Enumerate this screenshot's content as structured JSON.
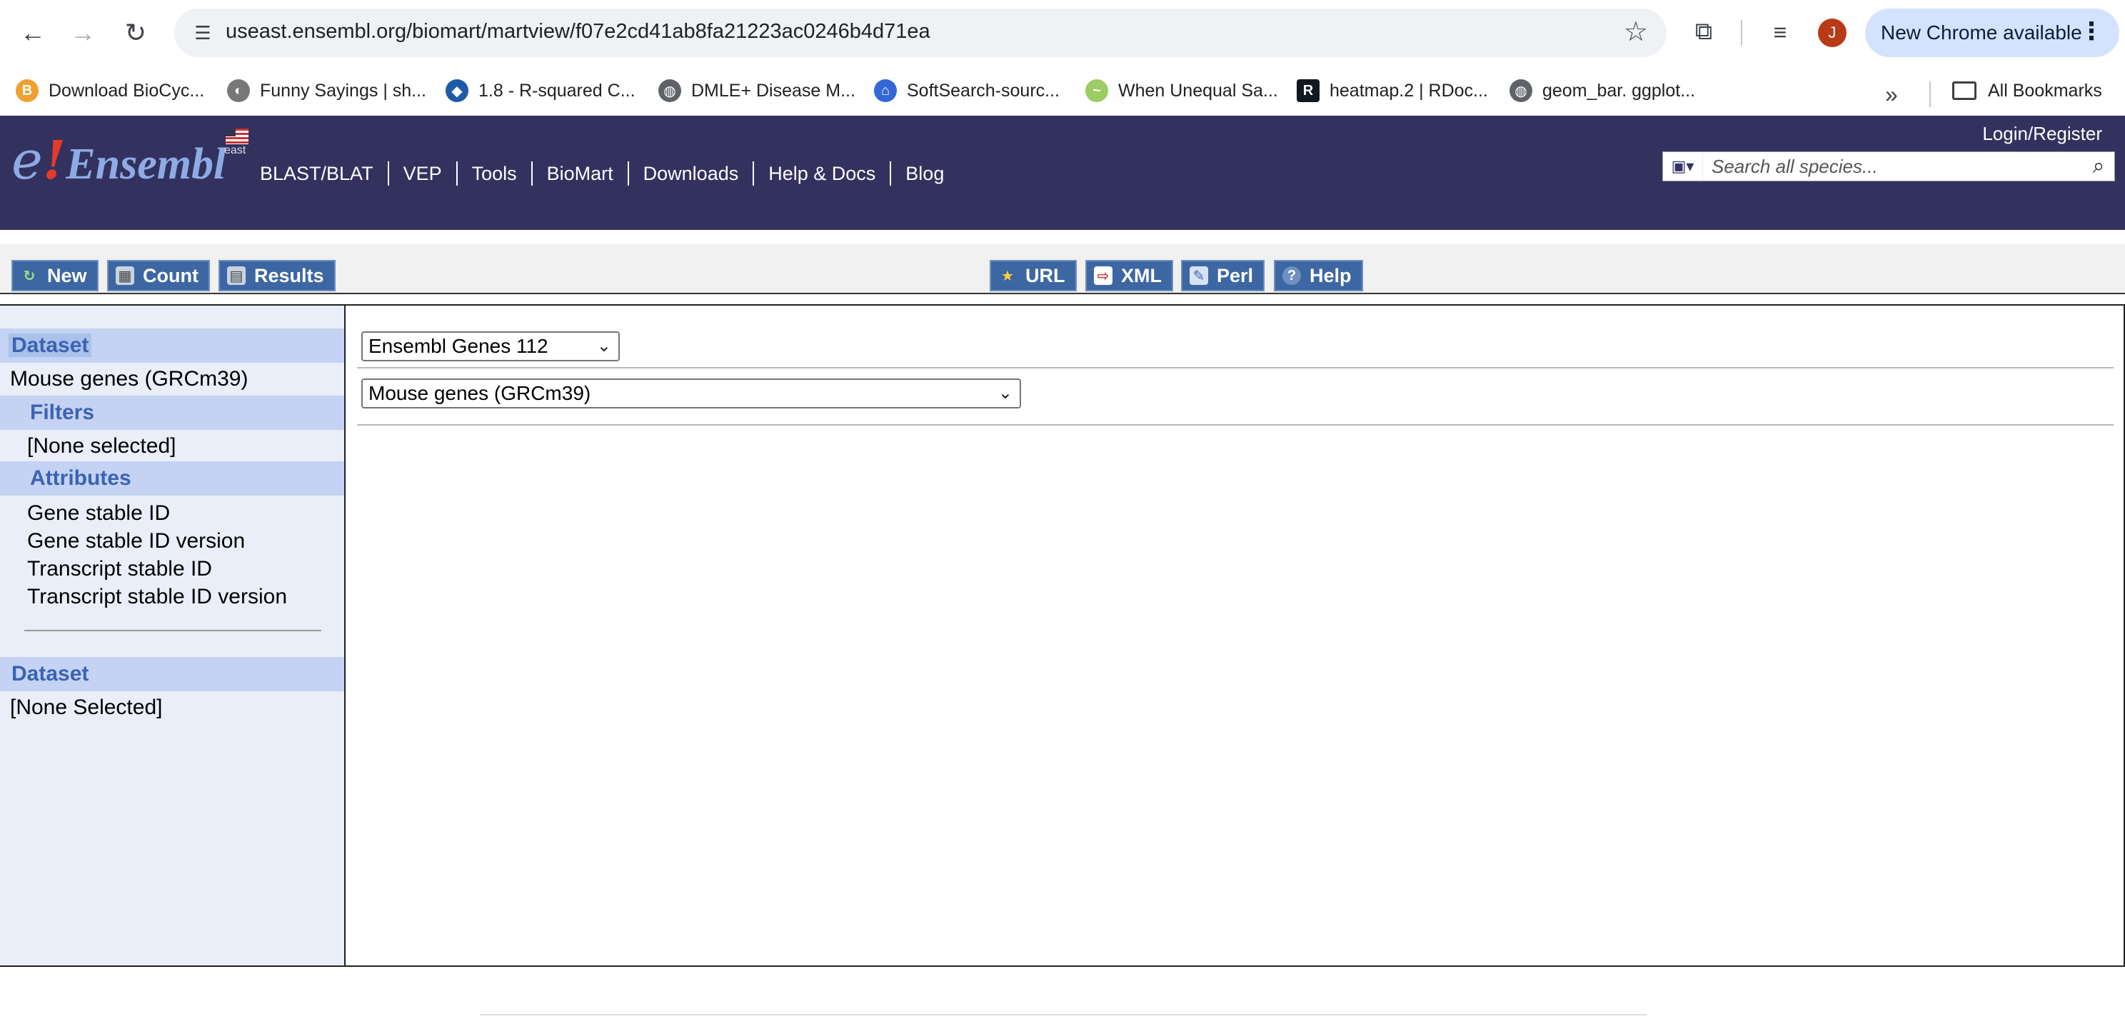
{
  "browser": {
    "url": "useast.ensembl.org/biomart/martview/f07e2cd41ab8fa21223ac0246b4d71ea",
    "profile_initial": "J",
    "update_label": "New Chrome available",
    "bookmarks": [
      {
        "label": "Download BioCyc...",
        "color": "#f0a030",
        "glyph": "B"
      },
      {
        "label": "Funny Sayings | sh...",
        "color": "#777777",
        "glyph": "◐"
      },
      {
        "label": "1.8 - R-squared C...",
        "color": "#1f5aa8",
        "glyph": "◆"
      },
      {
        "label": "DMLE+ Disease M...",
        "color": "#5f6368",
        "glyph": "◍"
      },
      {
        "label": "SoftSearch-sourc...",
        "color": "#3367d6",
        "glyph": "⌂"
      },
      {
        "label": "When Unequal Sa...",
        "color": "#9ccc65",
        "glyph": "~"
      },
      {
        "label": "heatmap.2 | RDoc...",
        "color": "#101820",
        "glyph": "R"
      },
      {
        "label": "geom_bar. ggplot...",
        "color": "#5f6368",
        "glyph": "◍"
      }
    ],
    "all_bookmarks": "All Bookmarks"
  },
  "ensembl": {
    "logo_e": "e",
    "logo_bang": "!",
    "logo_word": "Ensembl",
    "mirror_label": "east",
    "nav": [
      "BLAST/BLAT",
      "VEP",
      "Tools",
      "BioMart",
      "Downloads",
      "Help & Docs",
      "Blog"
    ],
    "login": "Login/Register",
    "search_placeholder": "Search all species..."
  },
  "mart_toolbar": {
    "left": [
      "New",
      "Count",
      "Results"
    ],
    "right": [
      "URL",
      "XML",
      "Perl",
      "Help"
    ]
  },
  "sidebar": {
    "dataset_header": "Dataset",
    "dataset_value": "Mouse genes (GRCm39)",
    "filters_header": "Filters",
    "filters_value": "[None selected]",
    "attributes_header": "Attributes",
    "attributes": [
      "Gene stable ID",
      "Gene stable ID version",
      "Transcript stable ID",
      "Transcript stable ID version"
    ],
    "dataset2_header": "Dataset",
    "dataset2_value": "[None Selected]"
  },
  "content": {
    "database_select": "Ensembl Genes 112",
    "dataset_select": "Mouse genes (GRCm39)"
  },
  "colors": {
    "ensembl_header": "#33325f",
    "mart_button": "#3d67a3",
    "section_header": "#c4d3f3",
    "section_text": "#3b63b2"
  }
}
